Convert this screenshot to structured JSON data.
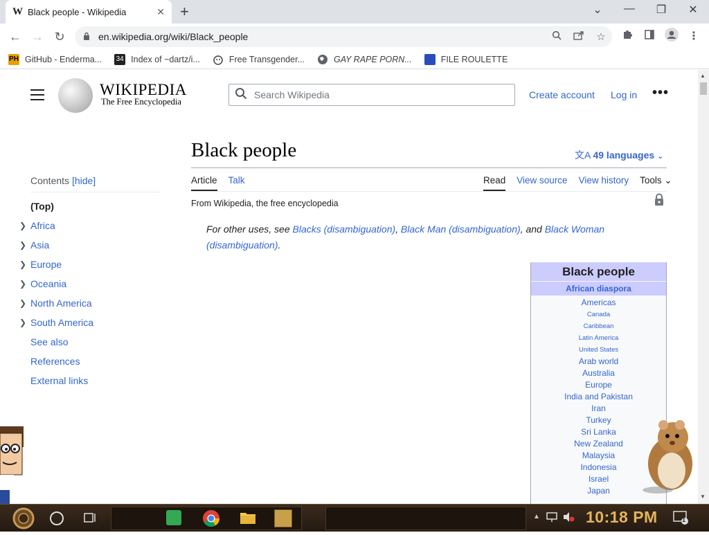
{
  "browser": {
    "tab_favicon": "W",
    "tab_title": "Black people - Wikipedia",
    "tab_close": "✕",
    "new_tab": "+",
    "window_controls": {
      "minimize": "—",
      "restore": "❐",
      "close": "✕",
      "tabsearch": "⌄"
    },
    "url": "en.wikipedia.org/wiki/Black_people",
    "bookmarks": [
      {
        "label": "GitHub - Enderma...",
        "icon": "PH",
        "color": "#e8a000"
      },
      {
        "label": "Index of ~dartz/i...",
        "icon": "34",
        "color": "#222222"
      },
      {
        "label": "Free Transgender...",
        "icon": "",
        "color": "#555555"
      },
      {
        "label": "GAY RAPE PORN...",
        "icon": "",
        "color": "#555555"
      },
      {
        "label": "FILE ROULETTE",
        "icon": "",
        "color": "#2a4dbb"
      }
    ]
  },
  "wiki": {
    "wordmark": "WIKIPEDIA",
    "tagline": "The Free Encyclopedia",
    "search_placeholder": "Search Wikipedia",
    "create_account": "Create account",
    "log_in": "Log in",
    "more": "•••",
    "toc": {
      "heading": "Contents",
      "hide": "[hide]",
      "items": [
        {
          "label": "(Top)"
        },
        {
          "label": "Africa",
          "expandable": true
        },
        {
          "label": "Asia",
          "expandable": true
        },
        {
          "label": "Europe",
          "expandable": true
        },
        {
          "label": "Oceania",
          "expandable": true
        },
        {
          "label": "North America",
          "expandable": true
        },
        {
          "label": "South America",
          "expandable": true
        },
        {
          "label": "See also"
        },
        {
          "label": "References"
        },
        {
          "label": "External links"
        }
      ]
    },
    "article": {
      "title": "Black people",
      "languages": "49 languages",
      "tab_article": "Article",
      "tab_talk": "Talk",
      "tab_read": "Read",
      "tab_view_source": "View source",
      "tab_view_history": "View history",
      "tab_tools": "Tools",
      "from": "From Wikipedia, the free encyclopedia",
      "hatnote": {
        "prefix": "For other uses, see ",
        "link1": "Blacks (disambiguation)",
        "sep1": ", ",
        "link2": "Black Man (disambiguation)",
        "sep2": ", and ",
        "link3": "Black Woman (disambiguation)",
        "suffix": "."
      }
    },
    "infobox": {
      "title": "Black people",
      "subtitle": "African diaspora",
      "rows": [
        {
          "label": "Americas",
          "size": "big"
        },
        {
          "label": "Canada",
          "size": "small"
        },
        {
          "label": "Caribbean",
          "size": "small"
        },
        {
          "label": "Latin America",
          "size": "small"
        },
        {
          "label": "United States",
          "size": "small"
        },
        {
          "label": "Arab world",
          "size": "big"
        },
        {
          "label": "Australia",
          "size": "big"
        },
        {
          "label": "Europe",
          "size": "big"
        },
        {
          "label": "India and Pakistan",
          "size": "big"
        },
        {
          "label": "Iran",
          "size": "big"
        },
        {
          "label": "Turkey",
          "size": "big"
        },
        {
          "label": "Sri Lanka",
          "size": "big"
        },
        {
          "label": "New Zealand",
          "size": "big"
        },
        {
          "label": "Malaysia",
          "size": "big"
        },
        {
          "label": "Indonesia",
          "size": "big"
        },
        {
          "label": "Israel",
          "size": "big"
        },
        {
          "label": "Japan",
          "size": "big"
        }
      ]
    }
  },
  "taskbar": {
    "time": "10:18 PM",
    "notification_count": "1"
  }
}
